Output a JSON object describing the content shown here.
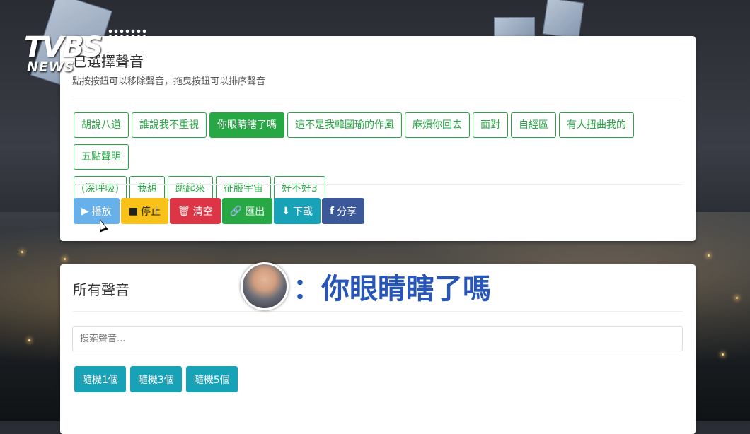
{
  "logo": {
    "brand": "TVBS",
    "sub": "NEWS"
  },
  "selected_panel": {
    "title": "已選擇聲音",
    "subtitle": "點按按鈕可以移除聲音，拖曳按鈕可以排序聲音",
    "tags": [
      {
        "label": "胡說八道",
        "active": false
      },
      {
        "label": "誰說我不重視",
        "active": false
      },
      {
        "label": "你眼睛瞎了嗎",
        "active": true
      },
      {
        "label": "這不是我韓國瑜的作風",
        "active": false
      },
      {
        "label": "麻煩你回去",
        "active": false
      },
      {
        "label": "面對",
        "active": false
      },
      {
        "label": "自經區",
        "active": false
      },
      {
        "label": "有人扭曲我的",
        "active": false
      },
      {
        "label": "五點聲明",
        "active": false
      },
      {
        "label": "(深呼吸)",
        "active": false
      },
      {
        "label": "我想",
        "active": false
      },
      {
        "label": "跳起來",
        "active": false
      },
      {
        "label": "征服宇宙",
        "active": false
      },
      {
        "label": "好不好3",
        "active": false
      }
    ],
    "actions": {
      "play": "播放",
      "stop": "停止",
      "clear": "清空",
      "export": "匯出",
      "download": "下載",
      "share": "分享"
    }
  },
  "all_panel": {
    "title": "所有聲音",
    "search_placeholder": "搜索聲音...",
    "random": [
      "隨機1個",
      "隨機3個",
      "隨機5個"
    ]
  },
  "caption": {
    "text": "：你眼睛瞎了嗎"
  }
}
